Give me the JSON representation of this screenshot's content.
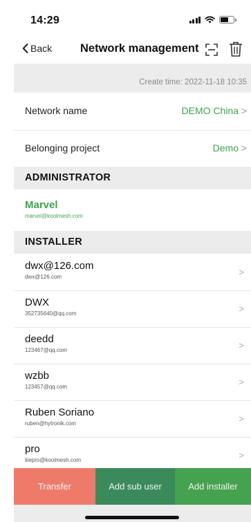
{
  "status_bar": {
    "time": "14:29"
  },
  "nav": {
    "back_label": "Back",
    "title": "Network management"
  },
  "create_time": "Create time: 2022-11-18 10:35",
  "settings": [
    {
      "label": "Network name",
      "value": "DEMO China"
    },
    {
      "label": "Belonging project",
      "value": "Demo"
    }
  ],
  "chevron": ">",
  "sections": {
    "administrator": "ADMINISTRATOR",
    "installer": "INSTALLER"
  },
  "administrator": {
    "name": "Marvel",
    "email": "marvel@koolmesh.com"
  },
  "installers": [
    {
      "name": "dwx@126.com",
      "email": "dwx@126.com"
    },
    {
      "name": "DWX",
      "email": "352735640@qq.com"
    },
    {
      "name": "deedd",
      "email": "123467@qq.com"
    },
    {
      "name": "wzbb",
      "email": "123457@qq.com"
    },
    {
      "name": "Ruben Soriano",
      "email": "ruben@hytronik.com"
    },
    {
      "name": "pro",
      "email": "liiepro@koolmesh.com"
    }
  ],
  "actions": {
    "transfer": "Transfer",
    "add_sub_user": "Add sub user",
    "add_installer": "Add installer"
  },
  "colors": {
    "accent_green": "#3fa34d",
    "transfer": "#ee7b6a",
    "add_sub_user": "#3b8a5c",
    "add_installer": "#45a24f",
    "section_bg": "#ececec"
  },
  "icons": {
    "back": "chevron-left-icon",
    "scan": "scan-icon",
    "delete": "trash-icon"
  }
}
